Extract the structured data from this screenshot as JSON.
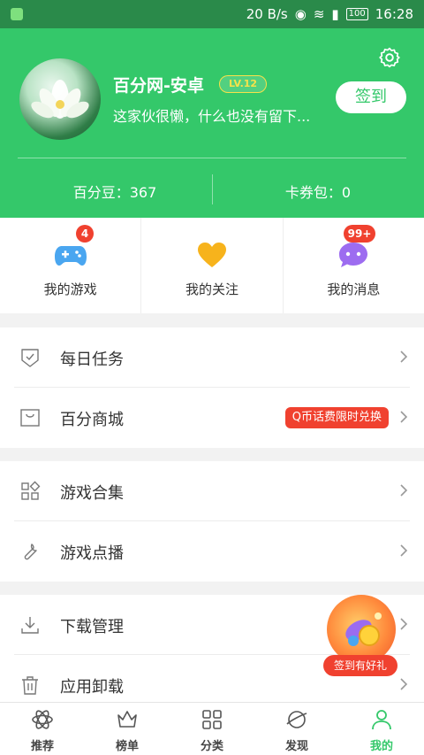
{
  "status_bar": {
    "speed": "20 B/s",
    "battery": "100",
    "time": "16:28"
  },
  "profile": {
    "username": "百分网-安卓",
    "level": "LV.12",
    "bio": "这家伙很懒，什么也没有留下...",
    "checkin_label": "签到",
    "beans": "百分豆：367",
    "coupons": "卡券包：0"
  },
  "quick_actions": [
    {
      "label": "我的游戏",
      "badge": "4",
      "icon": "gamepad-icon"
    },
    {
      "label": "我的关注",
      "badge": "",
      "icon": "heart-icon"
    },
    {
      "label": "我的消息",
      "badge": "99+",
      "icon": "message-icon"
    }
  ],
  "menu_groups": [
    [
      {
        "label": "每日任务",
        "icon": "shield-check-icon"
      },
      {
        "label": "百分商城",
        "icon": "shopping-bag-icon",
        "promo": "Q币话费限时兑换"
      }
    ],
    [
      {
        "label": "游戏合集",
        "icon": "grid-icon"
      },
      {
        "label": "游戏点播",
        "icon": "wrench-icon"
      }
    ],
    [
      {
        "label": "下载管理",
        "icon": "download-icon"
      },
      {
        "label": "应用卸载",
        "icon": "trash-icon"
      }
    ]
  ],
  "floating_gift": {
    "caption": "签到有好礼"
  },
  "bottom_nav": [
    {
      "label": "推荐",
      "icon": "atom-icon"
    },
    {
      "label": "榜单",
      "icon": "crown-icon"
    },
    {
      "label": "分类",
      "icon": "categories-icon"
    },
    {
      "label": "发现",
      "icon": "planet-icon"
    },
    {
      "label": "我的",
      "icon": "person-icon",
      "active": true
    }
  ],
  "colors": {
    "brand_green": "#34c86a",
    "status_green": "#2a8a4a",
    "badge_red": "#f0412f",
    "level_yellow": "#f7e24a"
  }
}
